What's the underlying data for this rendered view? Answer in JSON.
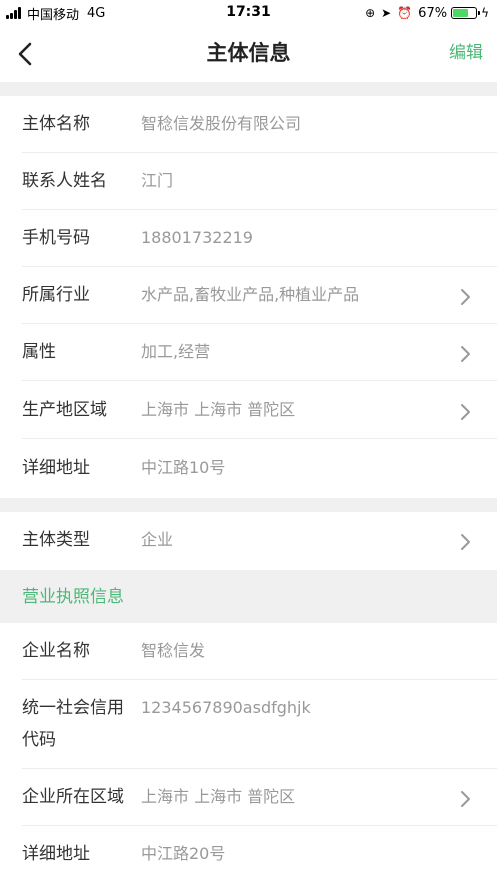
{
  "status_bar": {
    "carrier": "中国移动",
    "network": "4G",
    "time": "17:31",
    "battery_percent": "67%",
    "battery_level": 0.67
  },
  "nav": {
    "title": "主体信息",
    "edit_label": "编辑"
  },
  "subject": {
    "name_label": "主体名称",
    "name_value": "智稔信发股份有限公司",
    "contact_label": "联系人姓名",
    "contact_value": "江门",
    "phone_label": "手机号码",
    "phone_value": "18801732219",
    "industry_label": "所属行业",
    "industry_value": "水产品,畜牧业产品,种植业产品",
    "attribute_label": "属性",
    "attribute_value": "加工,经营",
    "region_label": "生产地区域",
    "region_value": "上海市 上海市 普陀区",
    "address_label": "详细地址",
    "address_value": "中江路10号"
  },
  "subject_type": {
    "label": "主体类型",
    "value": "企业"
  },
  "license": {
    "section_title": "营业执照信息",
    "company_name_label": "企业名称",
    "company_name_value": "智稔信发",
    "credit_code_label_line1": "统一社会信用",
    "credit_code_label_line2": "代码",
    "credit_code_value": "1234567890asdfghjk",
    "company_region_label": "企业所在区域",
    "company_region_value": "上海市 上海市 普陀区",
    "company_address_label": "详细地址",
    "company_address_value": "中江路20号"
  },
  "colors": {
    "accent": "#4cb877",
    "background_gap": "#f0f0f0",
    "label_text": "#333333",
    "value_text": "#999999"
  }
}
